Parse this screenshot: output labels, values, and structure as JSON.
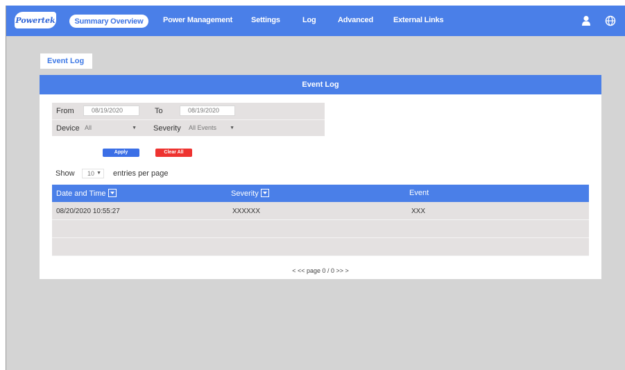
{
  "header": {
    "logo_text": "Powertek",
    "nav": [
      {
        "label": "Summary Overview",
        "active": true
      },
      {
        "label": "Power Management"
      },
      {
        "label": "Settings"
      },
      {
        "label": "Log"
      },
      {
        "label": "Advanced"
      },
      {
        "label": "External Links"
      }
    ],
    "icons": [
      "user-icon",
      "globe-icon"
    ]
  },
  "tabs": [
    {
      "label": "Event Log"
    }
  ],
  "panel": {
    "title": "Event Log"
  },
  "filters": {
    "from_label": "From",
    "from_value": "08/19/2020",
    "to_label": "To",
    "to_value": "08/19/2020",
    "device_label": "Device",
    "device_value": "All",
    "severity_label": "Severity",
    "severity_value": "All Events",
    "apply_label": "Apply",
    "clear_label": "Clear All"
  },
  "paging": {
    "show_label": "Show",
    "entries_value": "10",
    "entries_label": "entries per page",
    "pager_text": "< << page 0 / 0 >>  >"
  },
  "table": {
    "columns": [
      "Date and Time",
      "Severity",
      "Event"
    ],
    "rows": [
      [
        "08/20/2020 10:55:27",
        "XXXXXX",
        "XXX"
      ],
      [
        "",
        "",
        ""
      ],
      [
        "",
        "",
        ""
      ]
    ]
  },
  "colors": {
    "accent": "#4a7fe8",
    "clear_button": "#ee3330",
    "background": "#d4d4d4"
  }
}
